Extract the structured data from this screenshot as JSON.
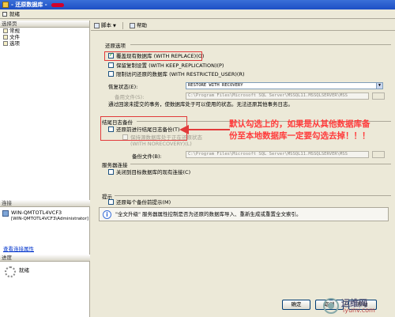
{
  "window": {
    "title": "- 还原数据库 -"
  },
  "status": {
    "text": "就绪"
  },
  "left": {
    "pages_header": "选择页",
    "pages": [
      {
        "label": "常规"
      },
      {
        "label": "文件"
      },
      {
        "label": "选项"
      }
    ],
    "connection_header": "连接",
    "connection_line1": "WIN-QMTOTL4VCF3",
    "connection_line2": "[WIN-QMTOTL4VCF3\\Administrator]",
    "view_connection": "查看连接属性",
    "progress_header": "进度",
    "progress_status": "就绪"
  },
  "toolbar": {
    "script_label": "脚本",
    "help_label": "帮助"
  },
  "restore_options": {
    "title": "还原选项",
    "overwrite": "覆盖现有数据库 (WITH REPLACE)(O)",
    "keep_replication": "保留复制设置 (WITH KEEP_REPLICATION)(P)",
    "restricted_user": "限制访问还原的数据库 (WITH RESTRICTED_USER)(R)",
    "recovery_label": "恢复状态(E):",
    "recovery_value": "RESTORE WITH RECOVERY",
    "standby_label": "备用文件(S):",
    "standby_value": "C:\\Program Files\\Microsoft SQL Server\\MSSQL11.MSSQLSERVER\\MSS",
    "note": "通过回滚未提交的事务，使数据库处于可以使用的状态。无法还原其他事务日志。"
  },
  "tail_log": {
    "title": "结尾日志备份",
    "take_backup": "还原前进行结尾日志备份(T)",
    "keep_source": "保持源数据库处于正在还原状态",
    "norecovery": "(WITH NORECOVERY)(L)",
    "backup_file_label": "备份文件(B):",
    "backup_file_value": "C:\\Program Files\\Microsoft SQL Server\\MSSQL11.MSSQLSERVER\\MSS"
  },
  "server_conn": {
    "title": "服务器连接",
    "close_conn": "关闭到目标数据库的现有连接(C)"
  },
  "prompt": {
    "title": "提示",
    "prompt_each": "还原每个备份前提示(M)",
    "info": "\"全文升级\" 服务器属性控制是否为还原的数据库导入、重新生成或重置全文索引。"
  },
  "annotation": {
    "line1": "默认勾选上的，如果是从其他数据库备",
    "line2": "份至本地数据库一定要勾选去掉！！！"
  },
  "buttons": {
    "ok": "确定",
    "cancel": "取消",
    "help": "帮助"
  },
  "watermark": {
    "brand": "运维网",
    "site": "iyunv.com"
  },
  "colors": {
    "accent": "#e23b3b",
    "title_bar": "#2a5fcf"
  }
}
